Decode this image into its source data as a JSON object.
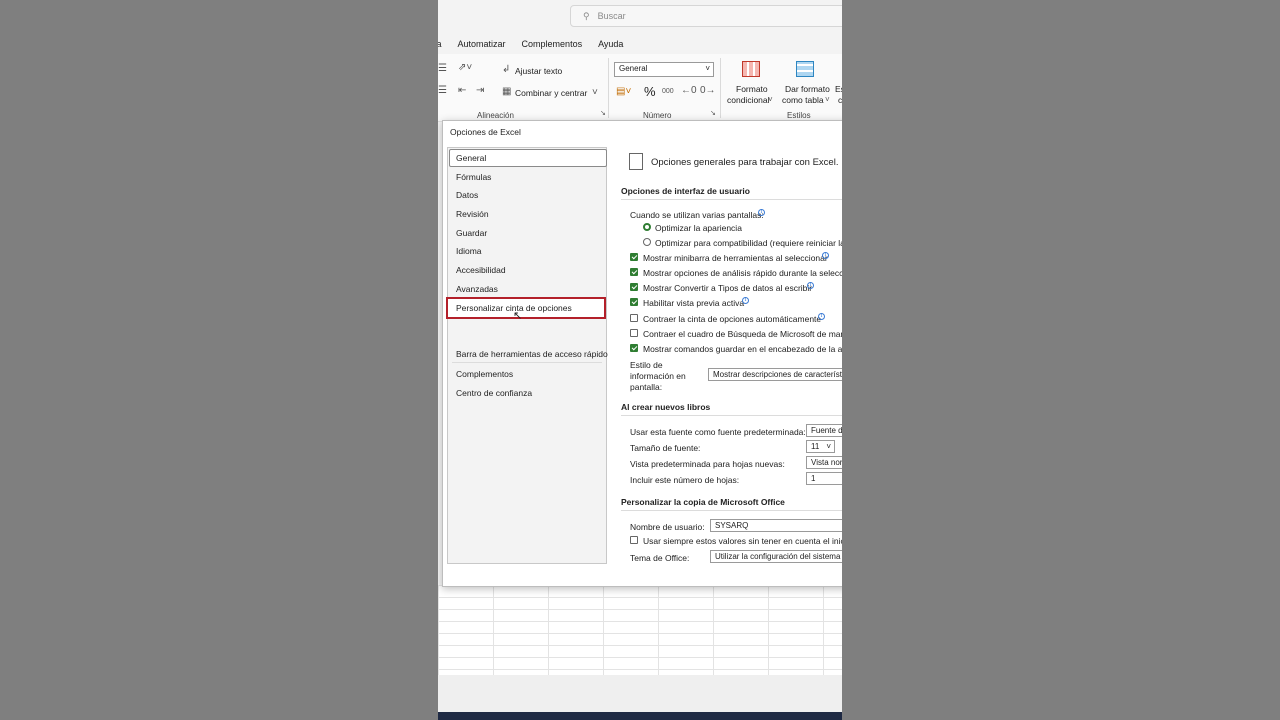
{
  "search": {
    "placeholder": "Buscar"
  },
  "menu": {
    "items": [
      "ta",
      "Automatizar",
      "Complementos",
      "Ayuda"
    ]
  },
  "ribbon": {
    "wrap_text": "Ajustar texto",
    "merge_center": "Combinar y centrar",
    "number_format": "General",
    "percent": "%",
    "thousands": "000",
    "conditional_format_1": "Formato",
    "conditional_format_2": "condicional",
    "table_format_1": "Dar formato",
    "table_format_2": "como tabla",
    "cell_styles_1": "Es",
    "cell_styles_2": "c",
    "group_alignment": "Alineación",
    "group_number": "Número",
    "group_styles": "Estilos"
  },
  "dialog": {
    "title": "Opciones de Excel",
    "nav": [
      "General",
      "Fórmulas",
      "Datos",
      "Revisión",
      "Guardar",
      "Idioma",
      "Accesibilidad",
      "Avanzadas",
      "Personalizar cinta de opciones",
      "Barra de herramientas de acceso rápido",
      "Complementos",
      "Centro de confianza"
    ],
    "header": "Opciones generales para trabajar con Excel.",
    "ui_section": "Opciones de interfaz de usuario",
    "multi_screen": "Cuando se utilizan varias pantallas:",
    "opt_appearance": "Optimizar la apariencia",
    "opt_compat": "Optimizar para compatibilidad (requiere reiniciar la a",
    "chk_minibar": "Mostrar minibarra de herramientas al seleccionar",
    "chk_quick": "Mostrar opciones de análisis rápido durante la selección",
    "chk_convert": "Mostrar Convertir a Tipos de datos al escribir",
    "chk_preview": "Habilitar vista previa activa",
    "chk_collapse": "Contraer la cinta de opciones automáticamente",
    "chk_search": "Contraer el cuadro de Búsqueda de Microsoft de maner",
    "chk_save": "Mostrar comandos guardar en el encabezado de la aplic",
    "tip_style_1": "Estilo de",
    "tip_style_2": "información en",
    "tip_style_3": "pantalla:",
    "tip_style_value": "Mostrar descripciones de característ",
    "new_books": "Al crear nuevos libros",
    "default_font": "Usar esta fuente como fuente predeterminada:",
    "default_font_value": "Fuente d",
    "font_size": "Tamaño de fuente:",
    "font_size_value": "11",
    "default_view": "Vista predeterminada para hojas nuevas:",
    "default_view_value": "Vista nor",
    "sheet_count": "Incluir este número de hojas:",
    "sheet_count_value": "1",
    "personalize": "Personalizar la copia de Microsoft Office",
    "username": "Nombre de usuario:",
    "username_value": "SYSARQ",
    "always_use": "Usar siempre estos valores sin tener en cuenta el inicio d",
    "office_theme": "Tema de Office:",
    "office_theme_value": "Utilizar la configuración del sistema"
  },
  "colors": {
    "highlight": "#b3202a",
    "check": "#2f7d32",
    "info": "#3a7bd5"
  }
}
